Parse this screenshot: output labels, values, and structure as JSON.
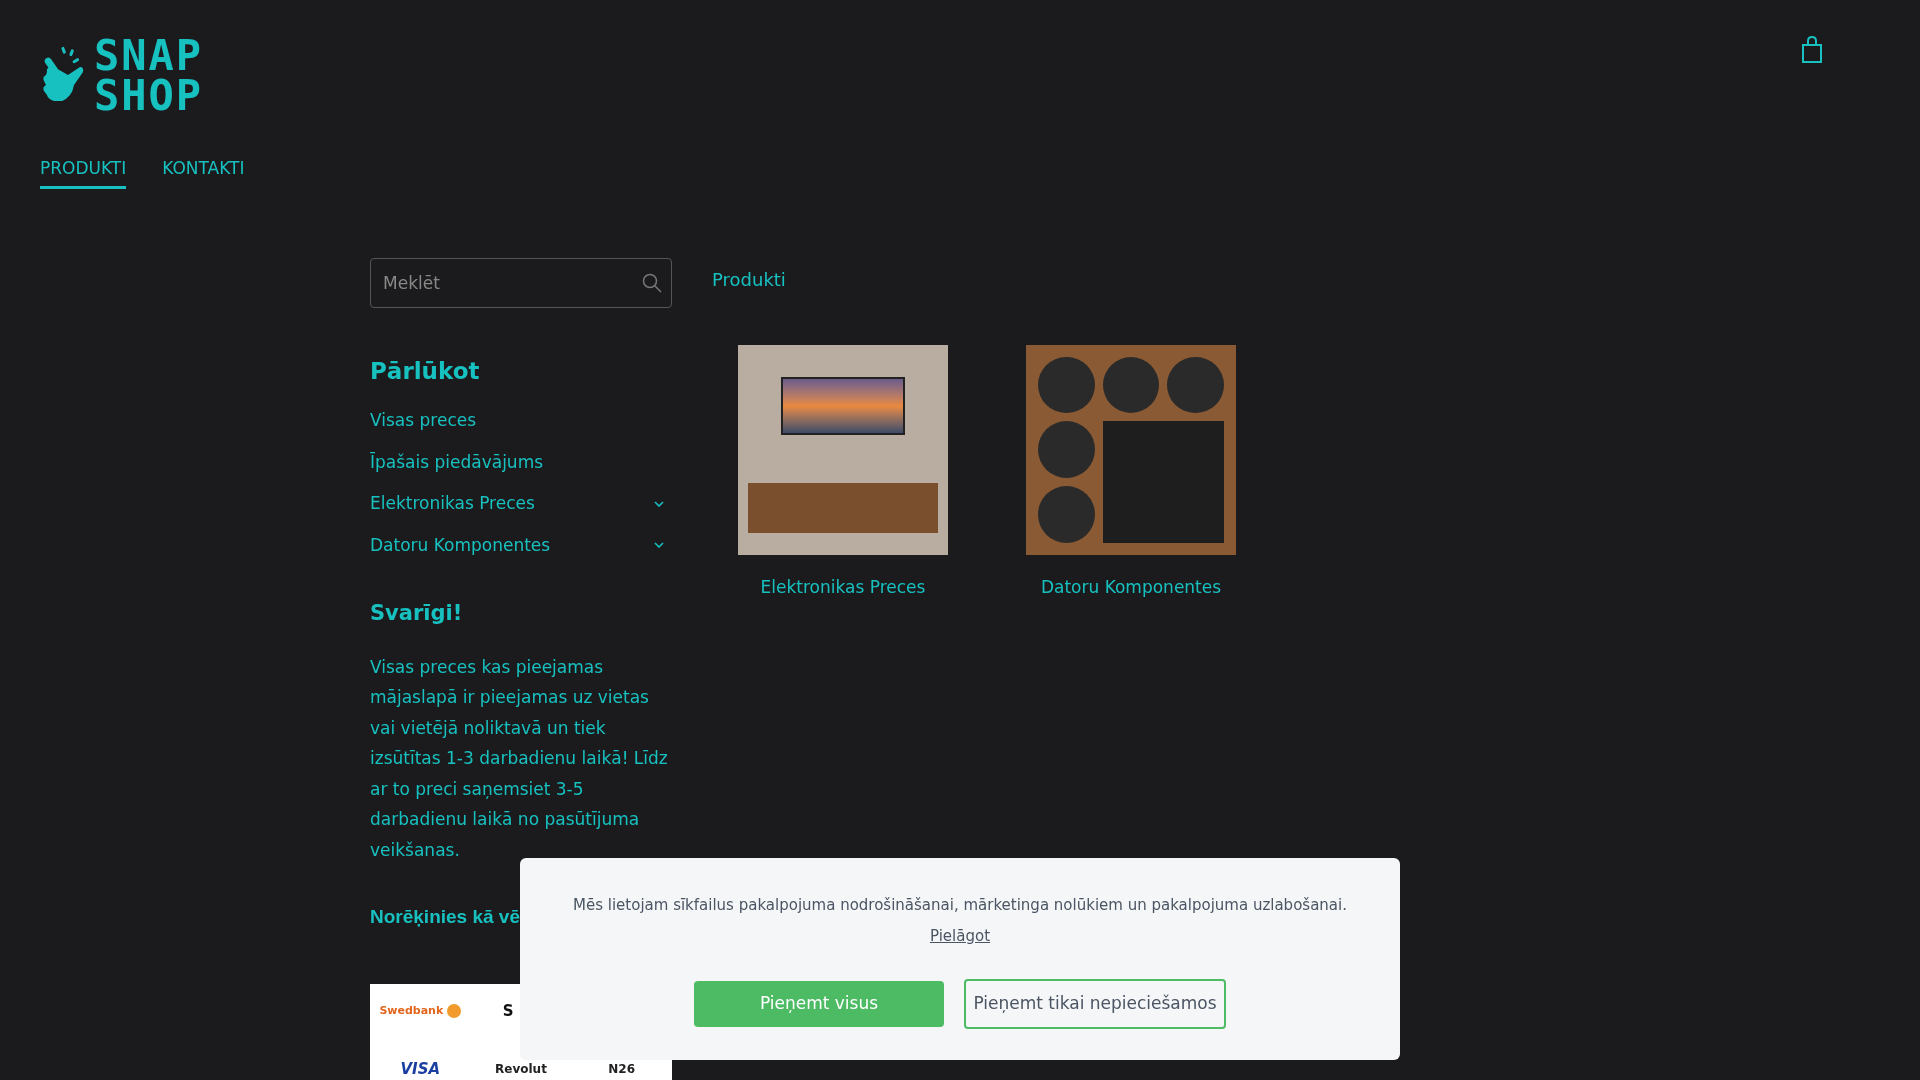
{
  "logo": {
    "lines": [
      "SNAP",
      "SHOP"
    ]
  },
  "nav": [
    {
      "label": "PRODUKTI",
      "selected": true
    },
    {
      "label": "KONTAKTI",
      "selected": false
    }
  ],
  "search": {
    "placeholder": "Meklēt"
  },
  "browse": {
    "title": "Pārlūkot",
    "items": [
      {
        "label": "Visas preces",
        "expandable": false
      },
      {
        "label": "Īpašais piedāvājums",
        "expandable": false
      },
      {
        "label": "Elektronikas Preces",
        "expandable": true
      },
      {
        "label": "Datoru Komponentes",
        "expandable": true
      }
    ]
  },
  "notice": {
    "title": "Svarīgi!",
    "text": "Visas preces kas pieejamas mājaslapā ir pieejamas uz vietas vai vietējā noliktavā un tiek izsūtītas 1-3 darbadienu laikā! Līdz ar to preci saņemsiet 3-5 darbadienu laikā no pasūtījuma veikšanas."
  },
  "payment": {
    "title": "Norēķinies kā vē",
    "logos": [
      [
        "Swedbank",
        "S"
      ],
      [
        "VISA",
        "Revolut",
        "N26"
      ]
    ]
  },
  "breadcrumb": "Produkti",
  "categories": [
    {
      "label": "Elektronikas Preces",
      "kind": "tv"
    },
    {
      "label": "Datoru Komponentes",
      "kind": "pc"
    }
  ],
  "cookie": {
    "text": "Mēs lietojam sīkfailus pakalpojuma nodrošināšanai, mārketinga nolūkiem un pakalpojuma uzlabošanai.",
    "link": "Pielāgot",
    "buttons": [
      {
        "label": "Pieņemt visus",
        "kind": "primary"
      },
      {
        "label": "Pieņemt tikai nepieciešamos",
        "kind": "outline"
      }
    ]
  }
}
